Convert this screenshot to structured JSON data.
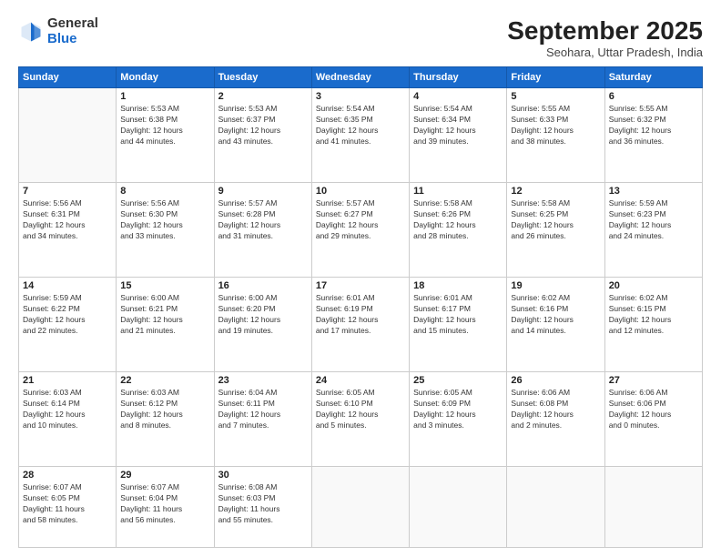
{
  "logo": {
    "general": "General",
    "blue": "Blue"
  },
  "title": {
    "month": "September 2025",
    "location": "Seohara, Uttar Pradesh, India"
  },
  "weekdays": [
    "Sunday",
    "Monday",
    "Tuesday",
    "Wednesday",
    "Thursday",
    "Friday",
    "Saturday"
  ],
  "weeks": [
    [
      {
        "day": "",
        "info": ""
      },
      {
        "day": "1",
        "info": "Sunrise: 5:53 AM\nSunset: 6:38 PM\nDaylight: 12 hours\nand 44 minutes."
      },
      {
        "day": "2",
        "info": "Sunrise: 5:53 AM\nSunset: 6:37 PM\nDaylight: 12 hours\nand 43 minutes."
      },
      {
        "day": "3",
        "info": "Sunrise: 5:54 AM\nSunset: 6:35 PM\nDaylight: 12 hours\nand 41 minutes."
      },
      {
        "day": "4",
        "info": "Sunrise: 5:54 AM\nSunset: 6:34 PM\nDaylight: 12 hours\nand 39 minutes."
      },
      {
        "day": "5",
        "info": "Sunrise: 5:55 AM\nSunset: 6:33 PM\nDaylight: 12 hours\nand 38 minutes."
      },
      {
        "day": "6",
        "info": "Sunrise: 5:55 AM\nSunset: 6:32 PM\nDaylight: 12 hours\nand 36 minutes."
      }
    ],
    [
      {
        "day": "7",
        "info": "Sunrise: 5:56 AM\nSunset: 6:31 PM\nDaylight: 12 hours\nand 34 minutes."
      },
      {
        "day": "8",
        "info": "Sunrise: 5:56 AM\nSunset: 6:30 PM\nDaylight: 12 hours\nand 33 minutes."
      },
      {
        "day": "9",
        "info": "Sunrise: 5:57 AM\nSunset: 6:28 PM\nDaylight: 12 hours\nand 31 minutes."
      },
      {
        "day": "10",
        "info": "Sunrise: 5:57 AM\nSunset: 6:27 PM\nDaylight: 12 hours\nand 29 minutes."
      },
      {
        "day": "11",
        "info": "Sunrise: 5:58 AM\nSunset: 6:26 PM\nDaylight: 12 hours\nand 28 minutes."
      },
      {
        "day": "12",
        "info": "Sunrise: 5:58 AM\nSunset: 6:25 PM\nDaylight: 12 hours\nand 26 minutes."
      },
      {
        "day": "13",
        "info": "Sunrise: 5:59 AM\nSunset: 6:23 PM\nDaylight: 12 hours\nand 24 minutes."
      }
    ],
    [
      {
        "day": "14",
        "info": "Sunrise: 5:59 AM\nSunset: 6:22 PM\nDaylight: 12 hours\nand 22 minutes."
      },
      {
        "day": "15",
        "info": "Sunrise: 6:00 AM\nSunset: 6:21 PM\nDaylight: 12 hours\nand 21 minutes."
      },
      {
        "day": "16",
        "info": "Sunrise: 6:00 AM\nSunset: 6:20 PM\nDaylight: 12 hours\nand 19 minutes."
      },
      {
        "day": "17",
        "info": "Sunrise: 6:01 AM\nSunset: 6:19 PM\nDaylight: 12 hours\nand 17 minutes."
      },
      {
        "day": "18",
        "info": "Sunrise: 6:01 AM\nSunset: 6:17 PM\nDaylight: 12 hours\nand 15 minutes."
      },
      {
        "day": "19",
        "info": "Sunrise: 6:02 AM\nSunset: 6:16 PM\nDaylight: 12 hours\nand 14 minutes."
      },
      {
        "day": "20",
        "info": "Sunrise: 6:02 AM\nSunset: 6:15 PM\nDaylight: 12 hours\nand 12 minutes."
      }
    ],
    [
      {
        "day": "21",
        "info": "Sunrise: 6:03 AM\nSunset: 6:14 PM\nDaylight: 12 hours\nand 10 minutes."
      },
      {
        "day": "22",
        "info": "Sunrise: 6:03 AM\nSunset: 6:12 PM\nDaylight: 12 hours\nand 8 minutes."
      },
      {
        "day": "23",
        "info": "Sunrise: 6:04 AM\nSunset: 6:11 PM\nDaylight: 12 hours\nand 7 minutes."
      },
      {
        "day": "24",
        "info": "Sunrise: 6:05 AM\nSunset: 6:10 PM\nDaylight: 12 hours\nand 5 minutes."
      },
      {
        "day": "25",
        "info": "Sunrise: 6:05 AM\nSunset: 6:09 PM\nDaylight: 12 hours\nand 3 minutes."
      },
      {
        "day": "26",
        "info": "Sunrise: 6:06 AM\nSunset: 6:08 PM\nDaylight: 12 hours\nand 2 minutes."
      },
      {
        "day": "27",
        "info": "Sunrise: 6:06 AM\nSunset: 6:06 PM\nDaylight: 12 hours\nand 0 minutes."
      }
    ],
    [
      {
        "day": "28",
        "info": "Sunrise: 6:07 AM\nSunset: 6:05 PM\nDaylight: 11 hours\nand 58 minutes."
      },
      {
        "day": "29",
        "info": "Sunrise: 6:07 AM\nSunset: 6:04 PM\nDaylight: 11 hours\nand 56 minutes."
      },
      {
        "day": "30",
        "info": "Sunrise: 6:08 AM\nSunset: 6:03 PM\nDaylight: 11 hours\nand 55 minutes."
      },
      {
        "day": "",
        "info": ""
      },
      {
        "day": "",
        "info": ""
      },
      {
        "day": "",
        "info": ""
      },
      {
        "day": "",
        "info": ""
      }
    ]
  ]
}
